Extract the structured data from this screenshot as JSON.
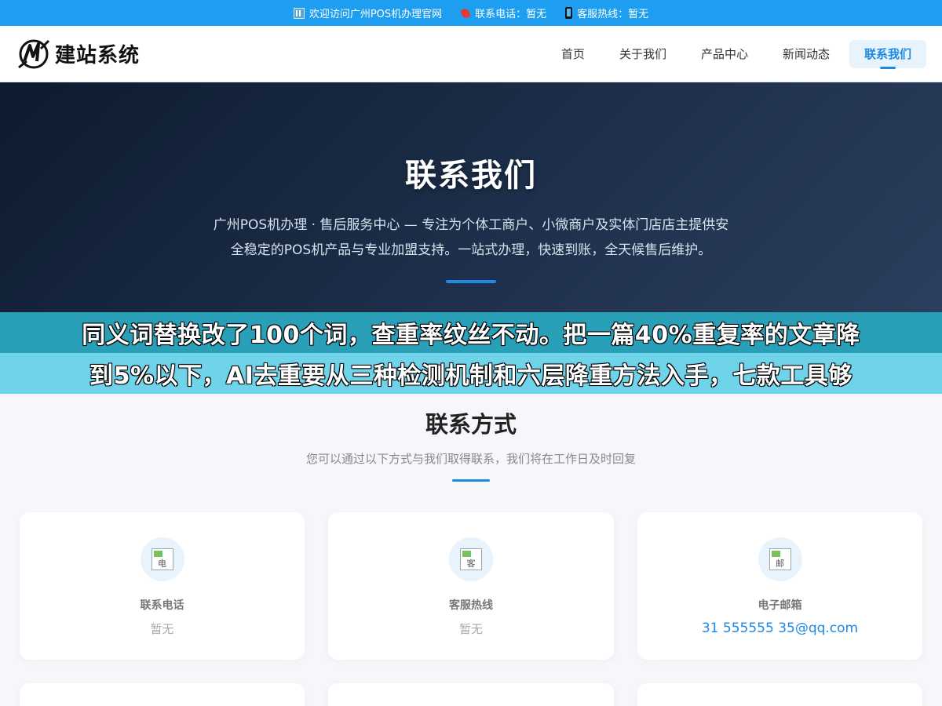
{
  "topbar": {
    "welcome": "欢迎访问广州POS机办理官网",
    "phone": "联系电话：暂无",
    "hotline": "客服热线：暂无"
  },
  "header": {
    "logo_text": "建站系统",
    "nav": [
      {
        "label": "首页"
      },
      {
        "label": "关于我们"
      },
      {
        "label": "产品中心"
      },
      {
        "label": "新闻动态"
      },
      {
        "label": "联系我们",
        "active": true
      }
    ]
  },
  "hero": {
    "title": "联系我们",
    "description": "广州POS机办理 · 售后服务中心 — 专注为个体工商户、小微商户及实体门店店主提供安全稳定的POS机产品与专业加盟支持。一站式办理，快速到账，全天候售后维护。"
  },
  "overlay": {
    "line1": "同义词替换改了100个词，查重率纹丝不动。把一篇40%重复率的文章降",
    "line2": "到5%以下，AI去重要从三种检测机制和六层降重方法入手，七款工具够"
  },
  "contact": {
    "title": "联系方式",
    "subtitle": "您可以通过以下方式与我们取得联系，我们将在工作日及时回复",
    "cards": [
      {
        "icon_alt": "电",
        "label": "联系电话",
        "value": "暂无"
      },
      {
        "icon_alt": "客",
        "label": "客服热线",
        "value": "暂无"
      },
      {
        "icon_alt": "邮",
        "label": "电子邮箱",
        "value": "31 555555 35@qq.com"
      }
    ]
  },
  "colors": {
    "topbar": "#1e9ef0",
    "accent": "#1e88e5",
    "hero_bg": "#1d2f4a",
    "overlay_top": "#2a9fb8",
    "overlay_bottom": "#6fd3ea"
  }
}
